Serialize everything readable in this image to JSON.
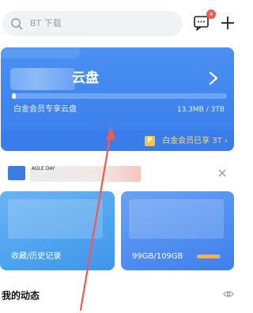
{
  "search": {
    "placeholder": "BT 下载"
  },
  "header": {
    "badge_count": "4"
  },
  "cloud_card": {
    "title": "云盘",
    "subtitle": "白金会员专享云盘",
    "usage": "13.3MB / 3TB",
    "used_fraction": 0.01,
    "vip_text": "白金会员已享 3T",
    "vip_icon": "P"
  },
  "ad": {
    "tag": "AGLE DAY"
  },
  "tiles": {
    "left": {
      "label": "收藏/历史记录"
    },
    "right": {
      "label": "99GB/109GB",
      "fill_fraction": 0.9
    }
  },
  "section": {
    "title": "我的动态"
  },
  "colors": {
    "accent": "#3f84ee",
    "arrow": "#f05a4f",
    "vip": "#ffd86b"
  }
}
